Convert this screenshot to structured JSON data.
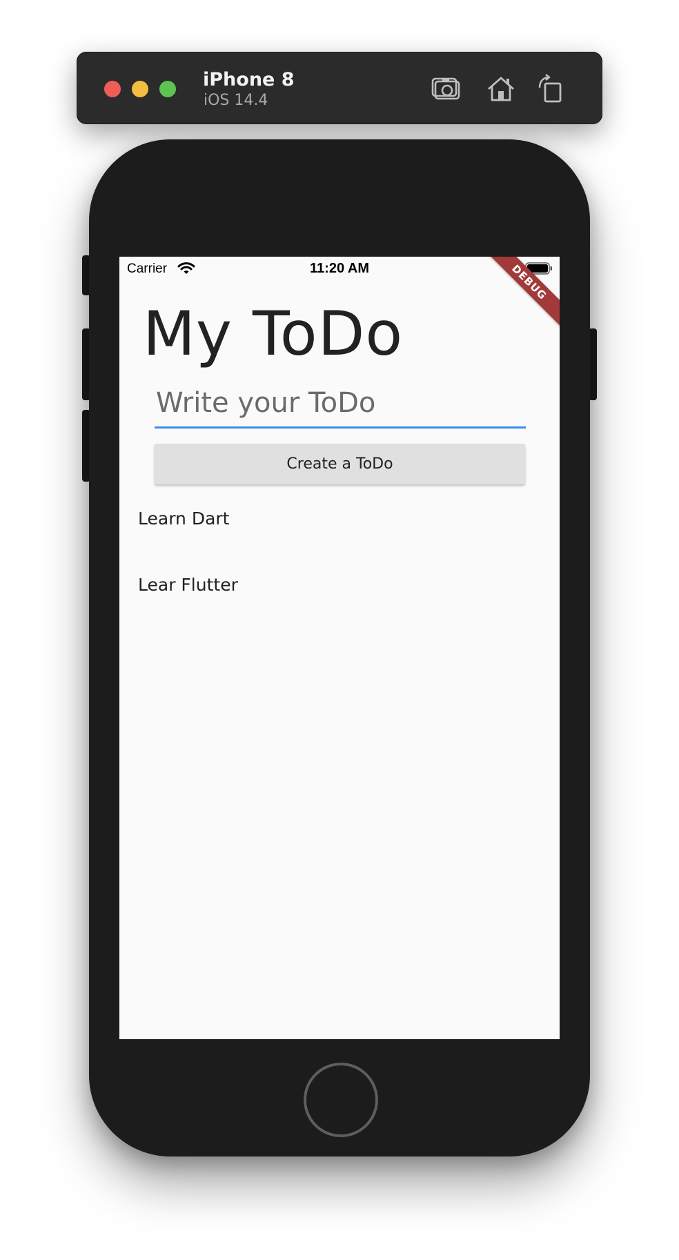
{
  "simulator": {
    "device_name": "iPhone 8",
    "os_version": "iOS 14.4",
    "toolbar": {
      "screenshot_icon": "camera-icon",
      "home_icon": "home-icon",
      "rotate_icon": "rotate-icon"
    },
    "colors": {
      "close": "#ee5e56",
      "minimize": "#f3bd3f",
      "zoom": "#5fc353"
    }
  },
  "status_bar": {
    "carrier": "Carrier",
    "time": "11:20 AM"
  },
  "debug_banner": "DEBUG",
  "app": {
    "title": "My ToDo",
    "input": {
      "placeholder": "Write your ToDo",
      "value": ""
    },
    "create_button_label": "Create a ToDo",
    "todos": [
      {
        "text": "Learn Dart"
      },
      {
        "text": "Lear Flutter"
      }
    ],
    "accent_color": "#3b8be6"
  }
}
